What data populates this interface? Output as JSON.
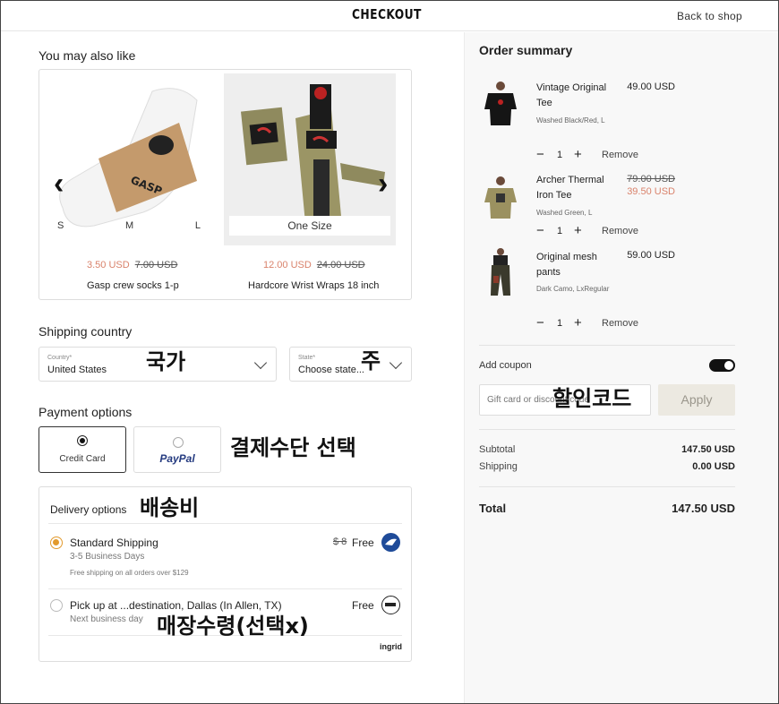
{
  "header": {
    "brand": "CHECKOUT",
    "back_link": "Back to shop"
  },
  "recommendations": {
    "title": "You may also like",
    "products": [
      {
        "name": "Gasp crew socks 1-p",
        "sale_price": "3.50 USD",
        "original_price": "7.00 USD",
        "sizes": [
          "S",
          "M",
          "L"
        ]
      },
      {
        "name": "Hardcore Wrist Wraps 18 inch",
        "sale_price": "12.00 USD",
        "original_price": "24.00 USD",
        "size_label": "One Size"
      }
    ]
  },
  "shipping": {
    "title": "Shipping country",
    "country_label": "Country*",
    "country_value": "United States",
    "state_label": "State*",
    "state_value": "Choose state..."
  },
  "payment": {
    "title": "Payment options",
    "credit_card_label": "Credit Card",
    "paypal_label": "PayPal"
  },
  "delivery": {
    "title": "Delivery options",
    "options": [
      {
        "name": "Standard Shipping",
        "time": "3-5 Business Days",
        "note": "Free shipping on all orders over $129",
        "old_price": "$ 8",
        "price": "Free",
        "selected": true
      },
      {
        "name": "Pick up at ...destination, Dallas (In Allen, TX)",
        "time": "Next business day",
        "price": "Free",
        "selected": false
      }
    ],
    "provider": "ingrid"
  },
  "annotations": {
    "country": "국가",
    "state": "주",
    "payment": "결제수단 선택",
    "delivery": "배송비",
    "pickup": "매장수령(선택x)",
    "coupon": "할인코드"
  },
  "summary": {
    "title": "Order summary",
    "items": [
      {
        "name": "Vintage Original Tee",
        "variant": "Washed Black/Red, L",
        "price": "49.00 USD",
        "qty": "1",
        "remove": "Remove"
      },
      {
        "name": "Archer Thermal Iron Tee",
        "variant": "Washed Green, L",
        "old_price": "79.00 USD",
        "price": "39.50 USD",
        "qty": "1",
        "remove": "Remove"
      },
      {
        "name": "Original mesh pants",
        "variant": "Dark Camo, LxRegular",
        "price": "59.00 USD",
        "qty": "1",
        "remove": "Remove"
      }
    ],
    "coupon_label": "Add coupon",
    "coupon_placeholder": "Gift card or discount code",
    "apply_label": "Apply",
    "subtotal_label": "Subtotal",
    "subtotal_value": "147.50 USD",
    "shipping_label": "Shipping",
    "shipping_value": "0.00 USD",
    "total_label": "Total",
    "total_value": "147.50 USD"
  },
  "colors": {
    "sale": "#d9826b",
    "accent": "#e29a2d",
    "toggle": "#111111",
    "paypal_dark": "#253b80",
    "paypal_light": "#179bd7"
  }
}
